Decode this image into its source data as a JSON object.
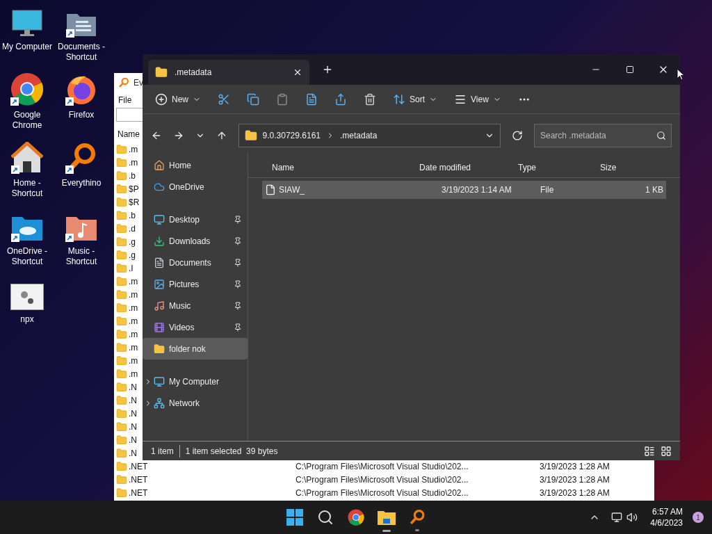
{
  "desktop_icons": [
    {
      "label": "My Computer",
      "kind": "monitor",
      "shortcut": false
    },
    {
      "label": "Documents - Shortcut",
      "kind": "documents",
      "shortcut": true
    },
    {
      "label": "Google Chrome",
      "kind": "chrome",
      "shortcut": true
    },
    {
      "label": "Firefox",
      "kind": "firefox",
      "shortcut": true
    },
    {
      "label": "Home - Shortcut",
      "kind": "home",
      "shortcut": true
    },
    {
      "label": "Everythino",
      "kind": "everything",
      "shortcut": true
    },
    {
      "label": "OneDrive - Shortcut",
      "kind": "onedrive",
      "shortcut": true
    },
    {
      "label": "Music - Shortcut",
      "kind": "music",
      "shortcut": true
    },
    {
      "label": "npx",
      "kind": "app",
      "shortcut": false
    }
  ],
  "everything_window": {
    "title": "Ev",
    "menu": [
      "File"
    ],
    "columns": [
      "Name"
    ],
    "rows": [
      {
        "name": ".m"
      },
      {
        "name": ".m"
      },
      {
        "name": ".b"
      },
      {
        "name": "$P"
      },
      {
        "name": "$R"
      },
      {
        "name": ".b"
      },
      {
        "name": ".d"
      },
      {
        "name": ".g"
      },
      {
        "name": ".g"
      },
      {
        "name": ".I"
      },
      {
        "name": ".m"
      },
      {
        "name": ".m"
      },
      {
        "name": ".m"
      },
      {
        "name": ".m"
      },
      {
        "name": ".m"
      },
      {
        "name": ".m"
      },
      {
        "name": ".m"
      },
      {
        "name": ".m"
      },
      {
        "name": ".N"
      },
      {
        "name": ".N"
      },
      {
        "name": ".N"
      },
      {
        "name": ".N"
      },
      {
        "name": ".N"
      },
      {
        "name": ".N"
      },
      {
        "name": ".NET",
        "path": "C:\\Program Files\\Microsoft Visual Studio\\202...",
        "date": "3/19/2023 1:28 AM"
      },
      {
        "name": ".NET",
        "path": "C:\\Program Files\\Microsoft Visual Studio\\202...",
        "date": "3/19/2023 1:28 AM"
      },
      {
        "name": ".NET",
        "path": "C:\\Program Files\\Microsoft Visual Studio\\202...",
        "date": "3/19/2023 1:28 AM"
      }
    ]
  },
  "explorer_window": {
    "tab": {
      "label": ".metadata"
    },
    "toolbar": {
      "new": "New",
      "sort": "Sort",
      "view": "View"
    },
    "breadcrumb": [
      "9.0.30729.6161",
      ".metadata"
    ],
    "search": {
      "placeholder": "Search .metadata"
    },
    "sidebar": [
      {
        "label": "Home",
        "kind": "home",
        "pinned": false,
        "selected": false,
        "expandable": false
      },
      {
        "label": "OneDrive",
        "kind": "onedrive",
        "pinned": false,
        "selected": false,
        "expandable": false
      },
      {
        "label": "Desktop",
        "kind": "desktop",
        "pinned": true,
        "selected": false,
        "expandable": false
      },
      {
        "label": "Downloads",
        "kind": "downloads",
        "pinned": true,
        "selected": false,
        "expandable": false
      },
      {
        "label": "Documents",
        "kind": "documents",
        "pinned": true,
        "selected": false,
        "expandable": false
      },
      {
        "label": "Pictures",
        "kind": "pictures",
        "pinned": true,
        "selected": false,
        "expandable": false
      },
      {
        "label": "Music",
        "kind": "music",
        "pinned": true,
        "selected": false,
        "expandable": false
      },
      {
        "label": "Videos",
        "kind": "videos",
        "pinned": true,
        "selected": false,
        "expandable": false
      },
      {
        "label": "folder nok",
        "kind": "folder",
        "pinned": false,
        "selected": true,
        "expandable": false
      },
      {
        "label": "My Computer",
        "kind": "computer",
        "pinned": false,
        "selected": false,
        "expandable": true
      },
      {
        "label": "Network",
        "kind": "network",
        "pinned": false,
        "selected": false,
        "expandable": true
      }
    ],
    "columns": [
      "Name",
      "Date modified",
      "Type",
      "Size"
    ],
    "files": [
      {
        "name": "SIAW_",
        "date": "3/19/2023 1:14 AM",
        "type": "File",
        "size": "1 KB",
        "selected": true
      }
    ],
    "status": {
      "count": "1 item",
      "selection": "1 item selected  39 bytes"
    }
  },
  "taskbar": {
    "apps": [
      {
        "kind": "start",
        "running": false
      },
      {
        "kind": "search",
        "running": false
      },
      {
        "kind": "chrome",
        "running": false
      },
      {
        "kind": "explorer",
        "running": true
      },
      {
        "kind": "everything",
        "running": true
      }
    ],
    "time": "6:57 AM",
    "date": "4/6/2023",
    "notifications": "1"
  }
}
